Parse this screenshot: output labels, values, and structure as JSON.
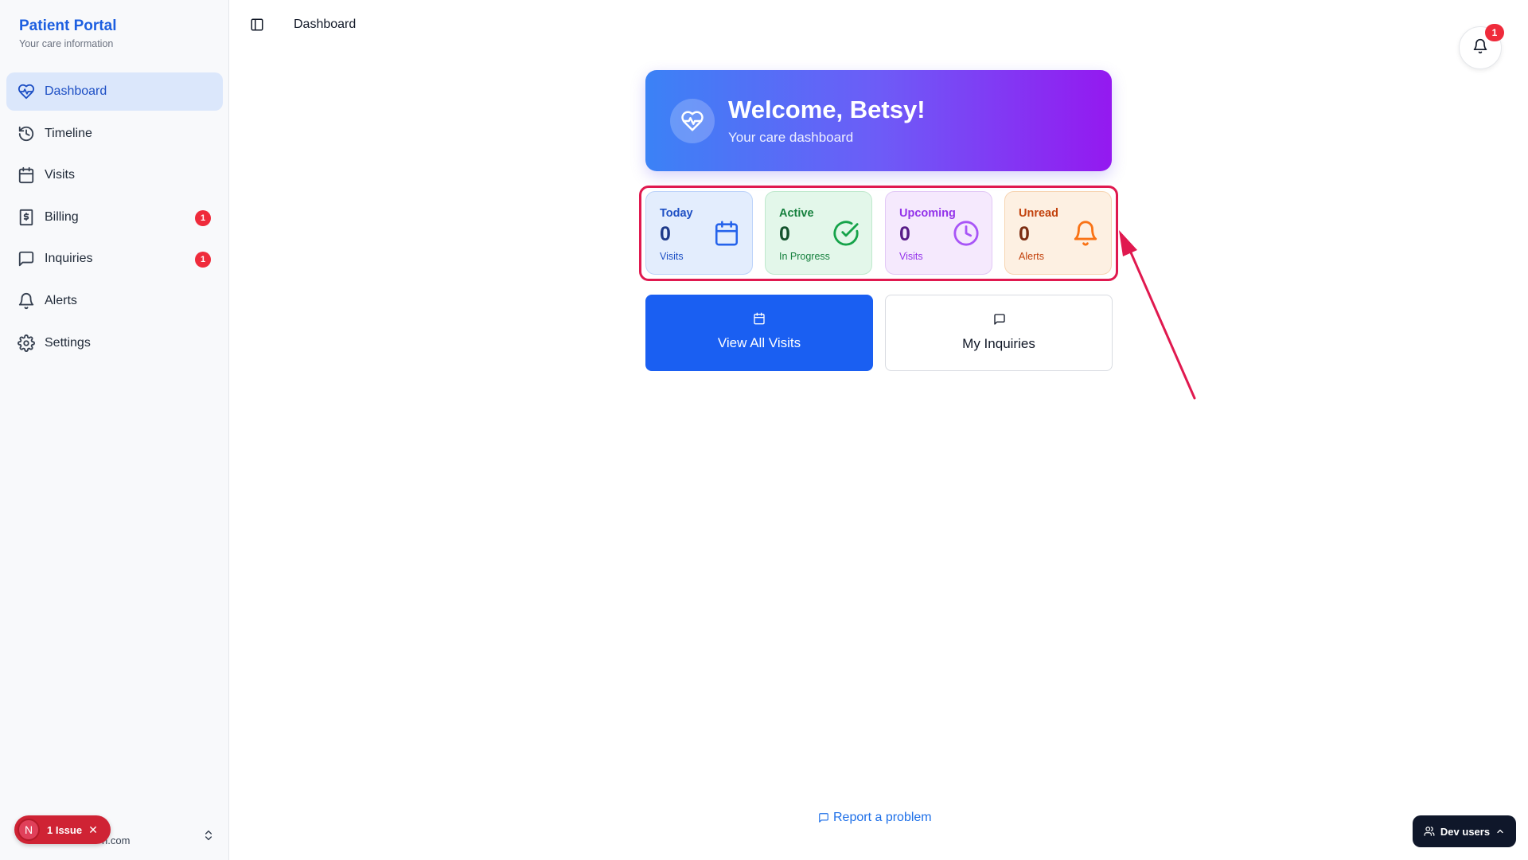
{
  "brand": {
    "title": "Patient Portal",
    "subtitle": "Your care information"
  },
  "sidebar": {
    "items": [
      {
        "label": "Dashboard",
        "icon": "heart-pulse-icon",
        "active": true
      },
      {
        "label": "Timeline",
        "icon": "history-icon"
      },
      {
        "label": "Visits",
        "icon": "calendar-icon"
      },
      {
        "label": "Billing",
        "icon": "dollar-receipt-icon",
        "badge": "1"
      },
      {
        "label": "Inquiries",
        "icon": "message-square-icon",
        "badge": "1"
      },
      {
        "label": "Alerts",
        "icon": "bell-icon"
      },
      {
        "label": "Settings",
        "icon": "gear-icon"
      }
    ],
    "footer_email": "n.com"
  },
  "issue_pill": {
    "initial": "N",
    "label": "1 Issue"
  },
  "header": {
    "title": "Dashboard",
    "notification_count": "1"
  },
  "welcome": {
    "title": "Welcome, Betsy!",
    "subtitle": "Your care dashboard"
  },
  "stats": [
    {
      "label": "Today",
      "value": "0",
      "sub": "Visits",
      "color": "#1d4fc4"
    },
    {
      "label": "Active",
      "value": "0",
      "sub": "In Progress",
      "color": "#15803d"
    },
    {
      "label": "Upcoming",
      "value": "0",
      "sub": "Visits",
      "color": "#9333ea"
    },
    {
      "label": "Unread",
      "value": "0",
      "sub": "Alerts",
      "color": "#c2410c"
    }
  ],
  "actions": {
    "visits_label": "View All Visits",
    "inquiries_label": "My Inquiries"
  },
  "footer": {
    "report_label": "Report a problem"
  },
  "dev_users": {
    "label": "Dev users"
  },
  "colors": {
    "accent": "#1a5ff2",
    "annotation": "#e0194f",
    "badge": "#ef2b3b"
  }
}
